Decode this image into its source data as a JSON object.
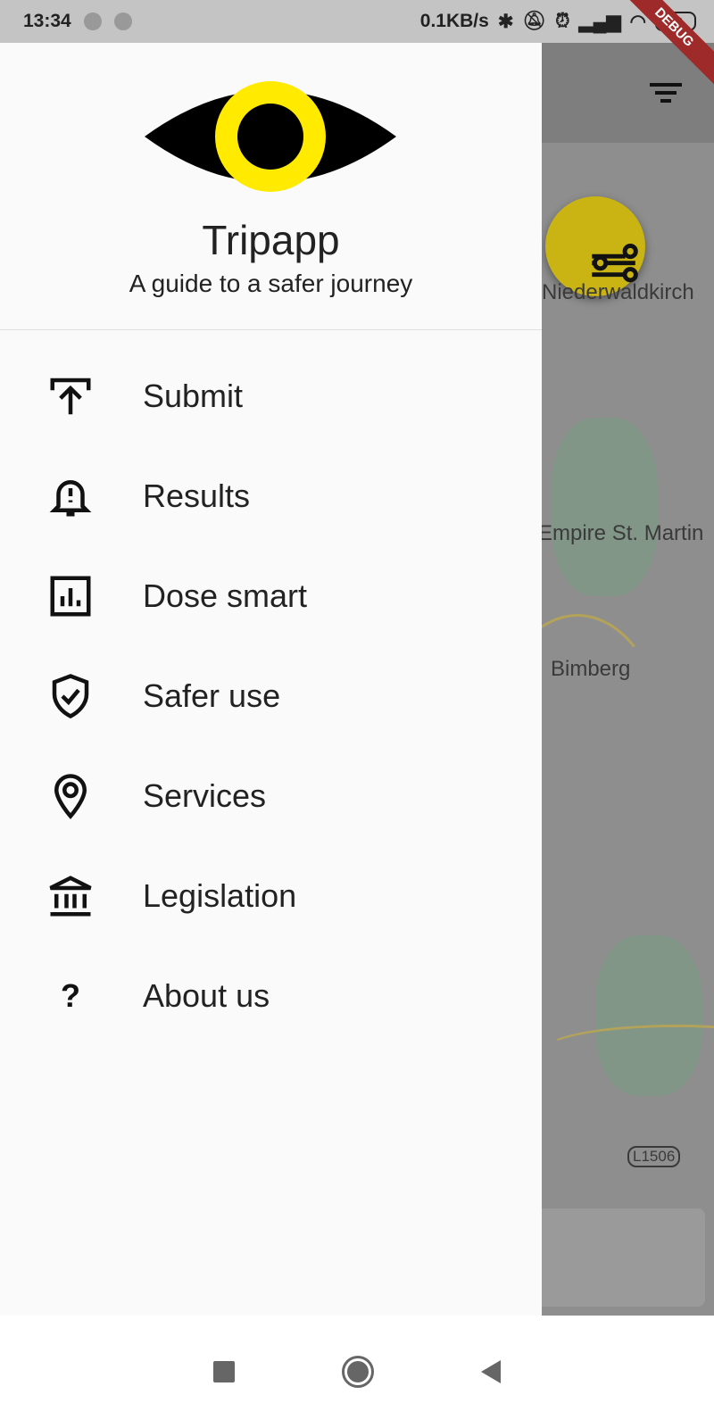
{
  "status_bar": {
    "time": "13:34",
    "net_speed": "0.1KB/s",
    "battery": "52",
    "icons": [
      "bluetooth-icon",
      "bell-off-icon",
      "alarm-icon",
      "signal-icon",
      "wifi-icon",
      "battery-icon"
    ]
  },
  "debug_banner": "DEBUG",
  "drawer": {
    "app_title": "Tripapp",
    "subtitle": "A guide to a safer journey",
    "items": [
      {
        "label": "Submit",
        "icon": "upload-icon"
      },
      {
        "label": "Results",
        "icon": "bell-alert-icon"
      },
      {
        "label": "Dose smart",
        "icon": "chart-icon"
      },
      {
        "label": "Safer use",
        "icon": "shield-check-icon"
      },
      {
        "label": "Services",
        "icon": "location-pin-icon"
      },
      {
        "label": "Legislation",
        "icon": "bank-icon"
      },
      {
        "label": "About us",
        "icon": "question-icon"
      }
    ]
  },
  "map": {
    "labels": [
      "Niederwaldkirch",
      "Empire St. Martin",
      "Bimberg",
      "L1506"
    ]
  },
  "colors": {
    "accent": "#ffea00",
    "fab": "#c9b414"
  }
}
